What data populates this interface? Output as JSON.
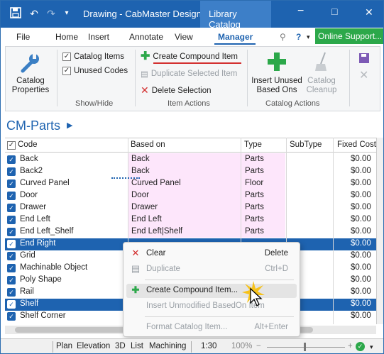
{
  "titlebar": {
    "title": "Drawing - CabMaster Designer",
    "context_tab": "Library Catalog",
    "minimize": "−",
    "maximize": "□",
    "close": "✕"
  },
  "menu": {
    "items": [
      "File",
      "Home",
      "Insert",
      "Annotate",
      "View",
      "Manager"
    ],
    "active": "Manager",
    "online_support": "Online Support..."
  },
  "ribbon": {
    "catalog_properties": "Catalog\nProperties",
    "catalog_properties_line1": "Catalog",
    "catalog_properties_line2": "Properties",
    "show_hide": {
      "label": "Show/Hide",
      "catalog_items": "Catalog Items",
      "unused_codes": "Unused Codes"
    },
    "item_actions": {
      "label": "Item Actions",
      "create_compound": "Create Compound Item",
      "duplicate_selected": "Duplicate Selected Item",
      "delete_selection": "Delete Selection"
    },
    "catalog_actions": {
      "label": "Catalog Actions",
      "insert_line1": "Insert Unused",
      "insert_line2": "Based Ons",
      "cleanup_line1": "Catalog",
      "cleanup_line2": "Cleanup"
    }
  },
  "section_title": "CM-Parts",
  "table": {
    "headers": [
      "Code",
      "Based on",
      "Type",
      "SubType",
      "Fixed Cost"
    ],
    "rows": [
      {
        "code": "Back",
        "based_on": "Back",
        "type": "Parts",
        "cost": "$0.00"
      },
      {
        "code": "Back2",
        "based_on": "Back",
        "type": "Parts",
        "cost": "$0.00"
      },
      {
        "code": "Curved Panel",
        "based_on": "Curved Panel",
        "type": "Floor",
        "cost": "$0.00"
      },
      {
        "code": "Door",
        "based_on": "Door",
        "type": "Parts",
        "cost": "$0.00"
      },
      {
        "code": "Drawer",
        "based_on": "Drawer",
        "type": "Parts",
        "cost": "$0.00"
      },
      {
        "code": "End Left",
        "based_on": "End Left",
        "type": "Parts",
        "cost": "$0.00"
      },
      {
        "code": "End Left_Shelf",
        "based_on": "End Left|Shelf",
        "type": "Parts",
        "cost": "$0.00"
      },
      {
        "code": "End Right",
        "based_on": "",
        "type": "",
        "cost": "$0.00"
      },
      {
        "code": "Grid",
        "based_on": "",
        "type": "",
        "cost": "$0.00"
      },
      {
        "code": "Machinable Object",
        "based_on": "",
        "type": "",
        "cost": "$0.00"
      },
      {
        "code": "Poly Shape",
        "based_on": "",
        "type": "",
        "cost": "$0.00"
      },
      {
        "code": "Rail",
        "based_on": "",
        "type": "",
        "cost": "$0.00"
      },
      {
        "code": "Shelf",
        "based_on": "",
        "type": "",
        "cost": "$0.00"
      },
      {
        "code": "Shelf Corner",
        "based_on": "",
        "type": "",
        "cost": "$0.00"
      }
    ],
    "selected_rows": [
      "End Right",
      "Shelf"
    ]
  },
  "context_menu": {
    "clear": "Clear",
    "clear_shortcut": "Delete",
    "duplicate": "Duplicate",
    "duplicate_shortcut": "Ctrl+D",
    "create_compound": "Create Compound Item...",
    "insert_unmodified": "Insert Unmodified BasedOn Item",
    "format_catalog": "Format Catalog Item...",
    "format_shortcut": "Alt+Enter"
  },
  "status": {
    "tabs": [
      "Plan",
      "Elevation",
      "3D",
      "List",
      "Machining"
    ],
    "scale": "1:30",
    "zoom": "100%"
  },
  "colors": {
    "accent": "#1e63b0",
    "online_green": "#2ca84a",
    "basedon_bg": "#fde6fb",
    "delete_red": "#d32f2f"
  }
}
